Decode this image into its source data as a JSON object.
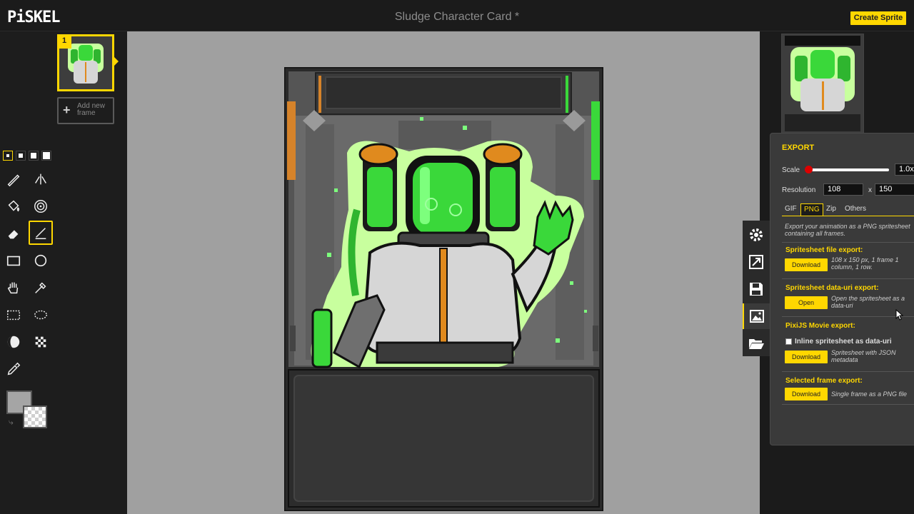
{
  "app": {
    "logo": "PiSKEL",
    "title": "Sludge Character Card *",
    "create_button": "Create Sprite"
  },
  "frames": {
    "items": [
      {
        "number": "1"
      }
    ],
    "add_frame_label": "Add new frame"
  },
  "tools": {
    "pen_sizes": [
      "pen-size-1",
      "pen-size-2",
      "pen-size-3",
      "pen-size-4"
    ],
    "items": [
      "pen-icon",
      "vertical-mirror-pen-icon",
      "paint-bucket-icon",
      "paint-same-color-icon",
      "eraser-icon",
      "stroke-icon",
      "rectangle-icon",
      "circle-icon",
      "move-hand-icon",
      "shape-selection-icon",
      "rectangle-select-icon",
      "lasso-select-icon",
      "lighten-icon",
      "dithering-icon",
      "color-picker-icon"
    ],
    "primary_color": "#a5a5a5",
    "secondary_color": "transparent"
  },
  "side_tools": [
    "settings-icon",
    "resize-icon",
    "save-icon",
    "export-image-icon",
    "open-folder-icon"
  ],
  "export": {
    "title": "EXPORT",
    "scale_label": "Scale",
    "scale_value": "1.0x",
    "scale_fraction": 0.0,
    "resolution_label": "Resolution",
    "width": "108",
    "x_sep": "x",
    "height": "150",
    "tabs": [
      "GIF",
      "PNG",
      "Zip",
      "Others"
    ],
    "active_tab": "PNG",
    "intro": "Export your animation as a PNG spritesheet containing all frames.",
    "spritesheet_file_title": "Spritesheet file export:",
    "spritesheet_file_button": "Download",
    "spritesheet_file_desc": "108 x 150 px, 1 frame 1 column, 1 row.",
    "data_uri_title": "Spritesheet data-uri export:",
    "data_uri_button": "Open",
    "data_uri_desc": "Open the spritesheet as a data-uri",
    "pixi_title": "PixiJS Movie export:",
    "pixi_checkbox_label": "Inline spritesheet as data-uri",
    "pixi_button": "Download",
    "pixi_desc": "Spritesheet with JSON metadata",
    "selected_title": "Selected frame export:",
    "selected_button": "Download",
    "selected_desc": "Single frame as a PNG file"
  },
  "colors": {
    "accent": "#ffd700",
    "slime_green": "#3ad83a",
    "glow": "#c8ff9e"
  }
}
